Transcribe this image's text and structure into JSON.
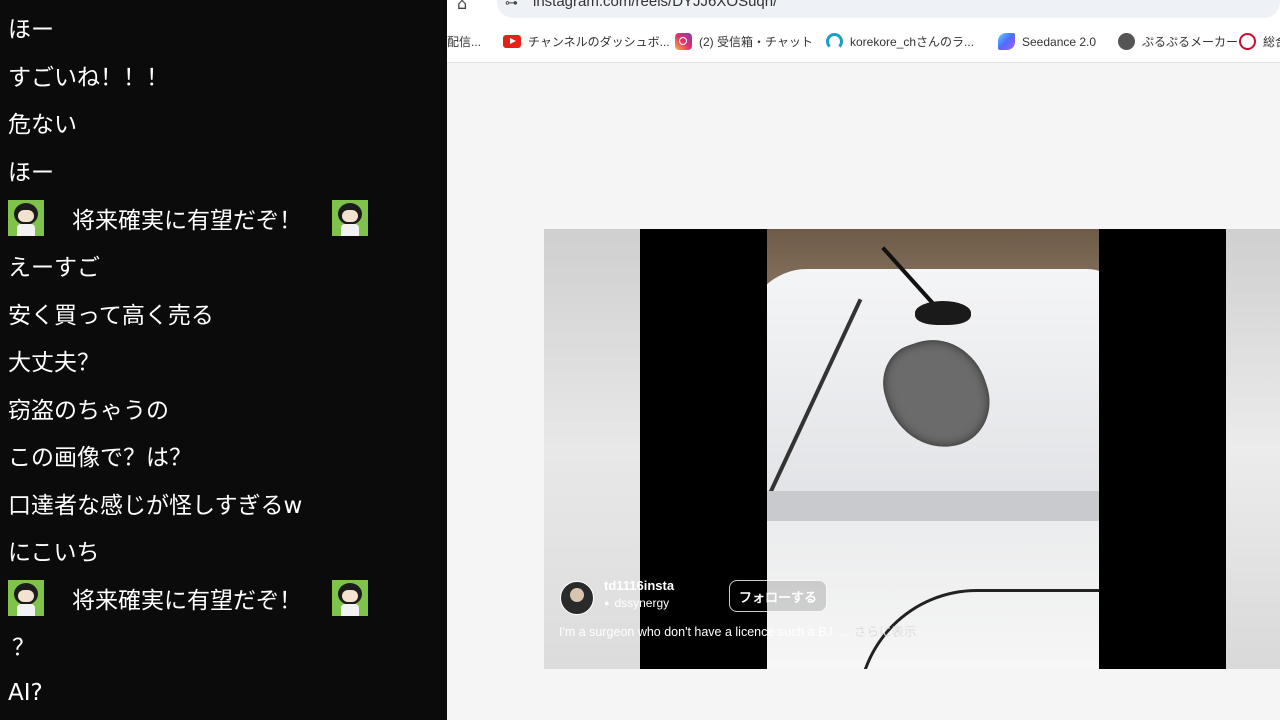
{
  "chat": {
    "messages": [
      {
        "text": "ほー"
      },
      {
        "text": "すごいね！！！"
      },
      {
        "text": "危ない"
      },
      {
        "text": "ほー"
      },
      {
        "text": "将来確実に有望だぞ！",
        "sticker": true
      },
      {
        "text": "えーすご"
      },
      {
        "text": "安く買って高く売る"
      },
      {
        "text": "大丈夫？"
      },
      {
        "text": "窃盗のちゃうの"
      },
      {
        "text": "この画像で？は？"
      },
      {
        "text": "口達者な感じが怪しすぎるw"
      },
      {
        "text": "にこいち"
      },
      {
        "text": "将来確実に有望だぞ！",
        "sticker": true
      },
      {
        "text": "？"
      },
      {
        "text": "AI?"
      }
    ]
  },
  "browser": {
    "url": "instagram.com/reels/DYJJ6XOSuqh/",
    "bookmarks": [
      {
        "label": "配信...",
        "icon": "none"
      },
      {
        "label": "チャンネルのダッシュボ...",
        "icon": "youtube-icon"
      },
      {
        "label": "(2) 受信箱・チャット",
        "icon": "instagram-icon"
      },
      {
        "label": "korekore_chさんのラ...",
        "icon": "arc-icon"
      },
      {
        "label": "Seedance 2.0",
        "icon": "seedance-icon"
      },
      {
        "label": "ぷるぷるメーカー",
        "icon": "globe-icon"
      },
      {
        "label": "総合",
        "icon": "red-circle-icon"
      }
    ]
  },
  "reel": {
    "username": "td1116insta",
    "subline": "dssynergy",
    "follow_label": "フォローする",
    "caption": "I'm a surgeon who don't have a licence such a BJ. ...",
    "more_label": "さらに表示"
  },
  "colors": {
    "chat_bg": "#0b0b0b",
    "chat_text": "#ffffff",
    "page_bg": "#f5f5f5"
  }
}
